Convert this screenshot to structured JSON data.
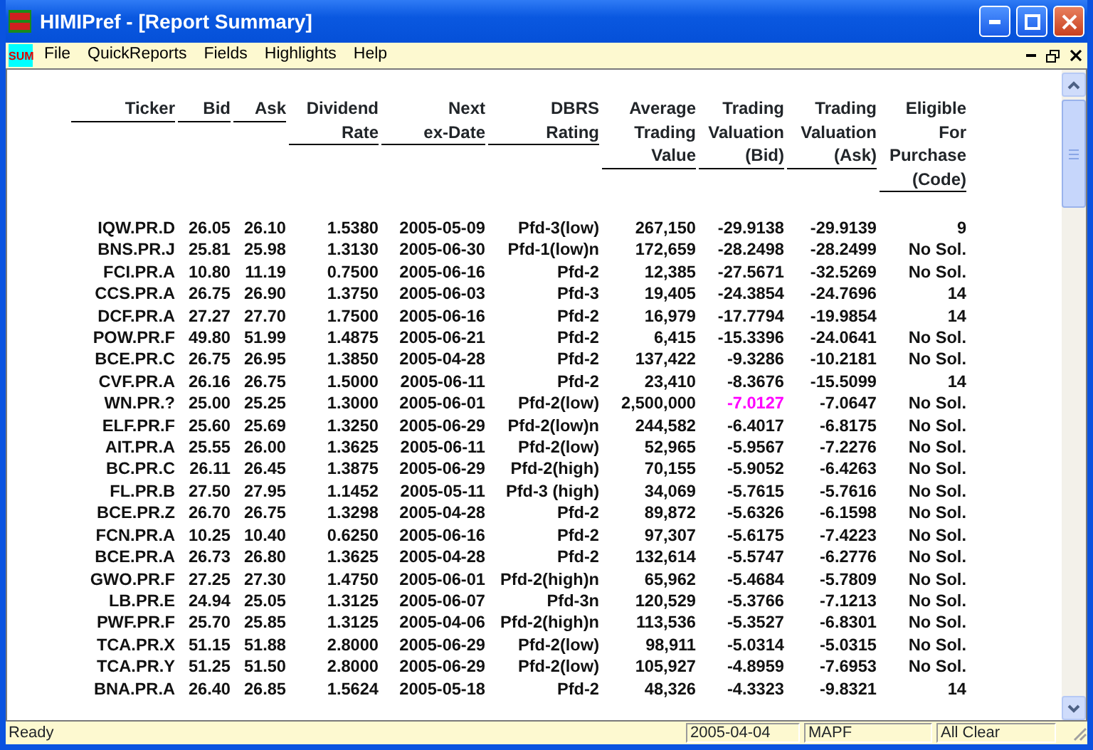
{
  "window": {
    "title": "HIMIPref - [Report Summary]"
  },
  "menu_bar": {
    "document_icon_label": "SUM",
    "items": [
      "File",
      "QuickReports",
      "Fields",
      "Highlights",
      "Help"
    ]
  },
  "table": {
    "columns": [
      {
        "lines": [
          "Ticker"
        ]
      },
      {
        "lines": [
          "Bid"
        ]
      },
      {
        "lines": [
          "Ask"
        ]
      },
      {
        "lines": [
          "Dividend",
          "Rate"
        ]
      },
      {
        "lines": [
          "Next",
          "ex-Date"
        ]
      },
      {
        "lines": [
          "DBRS",
          "Rating"
        ]
      },
      {
        "lines": [
          "Average",
          "Trading",
          "Value"
        ]
      },
      {
        "lines": [
          "Trading",
          "Valuation",
          "(Bid)"
        ]
      },
      {
        "lines": [
          "Trading",
          "Valuation",
          "(Ask)"
        ]
      },
      {
        "lines": [
          "Eligible",
          "For",
          "Purchase",
          "(Code)"
        ]
      }
    ],
    "rows": [
      {
        "cells": [
          "IQW.PR.D",
          "26.05",
          "26.10",
          "1.5380",
          "2005-05-09",
          "Pfd-3(low)",
          "267,150",
          "-29.9138",
          "-29.9139",
          "9"
        ]
      },
      {
        "cells": [
          "BNS.PR.J",
          "25.81",
          "25.98",
          "1.3130",
          "2005-06-30",
          "Pfd-1(low)n",
          "172,659",
          "-28.2498",
          "-28.2499",
          "No Sol."
        ]
      },
      {
        "cells": [
          "FCI.PR.A",
          "10.80",
          "11.19",
          "0.7500",
          "2005-06-16",
          "Pfd-2",
          "12,385",
          "-27.5671",
          "-32.5269",
          "No Sol."
        ]
      },
      {
        "cells": [
          "CCS.PR.A",
          "26.75",
          "26.90",
          "1.3750",
          "2005-06-03",
          "Pfd-3",
          "19,405",
          "-24.3854",
          "-24.7696",
          "14"
        ]
      },
      {
        "cells": [
          "DCF.PR.A",
          "27.27",
          "27.70",
          "1.7500",
          "2005-06-16",
          "Pfd-2",
          "16,979",
          "-17.7794",
          "-19.9854",
          "14"
        ]
      },
      {
        "cells": [
          "POW.PR.F",
          "49.80",
          "51.99",
          "1.4875",
          "2005-06-21",
          "Pfd-2",
          "6,415",
          "-15.3396",
          "-24.0641",
          "No Sol."
        ]
      },
      {
        "cells": [
          "BCE.PR.C",
          "26.75",
          "26.95",
          "1.3850",
          "2005-04-28",
          "Pfd-2",
          "137,422",
          "-9.3286",
          "-10.2181",
          "No Sol."
        ]
      },
      {
        "cells": [
          "CVF.PR.A",
          "26.16",
          "26.75",
          "1.5000",
          "2005-06-11",
          "Pfd-2",
          "23,410",
          "-8.3676",
          "-15.5099",
          "14"
        ]
      },
      {
        "cells": [
          "WN.PR.?",
          "25.00",
          "25.25",
          "1.3000",
          "2005-06-01",
          "Pfd-2(low)",
          "2,500,000",
          {
            "text": "-7.0127",
            "highlighted": true
          },
          "-7.0647",
          "No Sol."
        ]
      },
      {
        "cells": [
          "ELF.PR.F",
          "25.60",
          "25.69",
          "1.3250",
          "2005-06-29",
          "Pfd-2(low)n",
          "244,582",
          "-6.4017",
          "-6.8175",
          "No Sol."
        ]
      },
      {
        "cells": [
          "AIT.PR.A",
          "25.55",
          "26.00",
          "1.3625",
          "2005-06-11",
          "Pfd-2(low)",
          "52,965",
          "-5.9567",
          "-7.2276",
          "No Sol."
        ]
      },
      {
        "cells": [
          "BC.PR.C",
          "26.11",
          "26.45",
          "1.3875",
          "2005-06-29",
          "Pfd-2(high)",
          "70,155",
          "-5.9052",
          "-6.4263",
          "No Sol."
        ]
      },
      {
        "cells": [
          "FL.PR.B",
          "27.50",
          "27.95",
          "1.1452",
          "2005-05-11",
          "Pfd-3 (high)",
          "34,069",
          "-5.7615",
          "-5.7616",
          "No Sol."
        ]
      },
      {
        "cells": [
          "BCE.PR.Z",
          "26.70",
          "26.75",
          "1.3298",
          "2005-04-28",
          "Pfd-2",
          "89,872",
          "-5.6326",
          "-6.1598",
          "No Sol."
        ]
      },
      {
        "cells": [
          "FCN.PR.A",
          "10.25",
          "10.40",
          "0.6250",
          "2005-06-16",
          "Pfd-2",
          "97,307",
          "-5.6175",
          "-7.4223",
          "No Sol."
        ]
      },
      {
        "cells": [
          "BCE.PR.A",
          "26.73",
          "26.80",
          "1.3625",
          "2005-04-28",
          "Pfd-2",
          "132,614",
          "-5.5747",
          "-6.2776",
          "No Sol."
        ]
      },
      {
        "cells": [
          "GWO.PR.F",
          "27.25",
          "27.30",
          "1.4750",
          "2005-06-01",
          "Pfd-2(high)n",
          "65,962",
          "-5.4684",
          "-5.7809",
          "No Sol."
        ]
      },
      {
        "cells": [
          "LB.PR.E",
          "24.94",
          "25.05",
          "1.3125",
          "2005-06-07",
          "Pfd-3n",
          "120,529",
          "-5.3766",
          "-7.1213",
          "No Sol."
        ]
      },
      {
        "cells": [
          "PWF.PR.F",
          "25.70",
          "25.85",
          "1.3125",
          "2005-04-06",
          "Pfd-2(high)n",
          "113,536",
          "-5.3527",
          "-6.8301",
          "No Sol."
        ]
      },
      {
        "cells": [
          "TCA.PR.X",
          "51.15",
          "51.88",
          "2.8000",
          "2005-06-29",
          "Pfd-2(low)",
          "98,911",
          "-5.0314",
          "-5.0315",
          "No Sol."
        ]
      },
      {
        "cells": [
          "TCA.PR.Y",
          "51.25",
          "51.50",
          "2.8000",
          "2005-06-29",
          "Pfd-2(low)",
          "105,927",
          "-4.8959",
          "-7.6953",
          "No Sol."
        ]
      },
      {
        "cells": [
          "BNA.PR.A",
          "26.40",
          "26.85",
          "1.5624",
          "2005-05-18",
          "Pfd-2",
          "48,326",
          "-4.3323",
          "-9.8321",
          "14"
        ]
      }
    ]
  },
  "status_bar": {
    "message": "Ready",
    "fields": [
      "2005-04-04",
      "MAPF",
      "All Clear"
    ]
  }
}
